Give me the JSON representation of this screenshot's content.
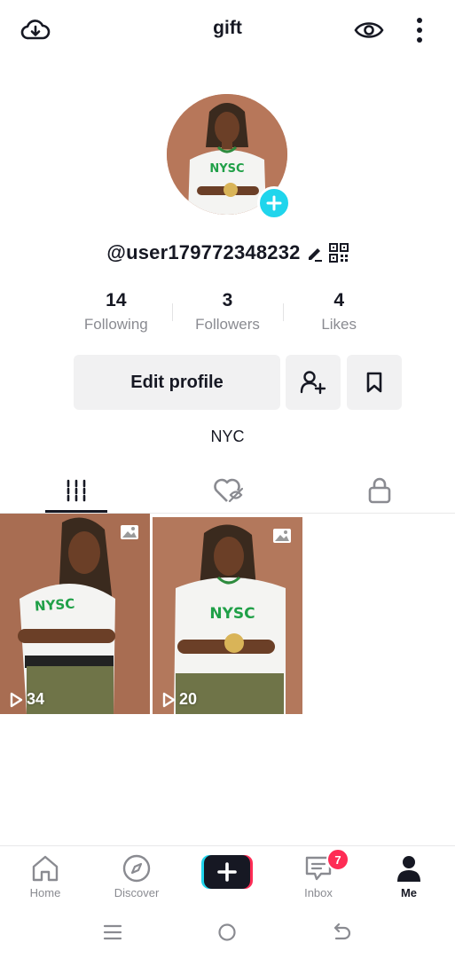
{
  "header": {
    "title": "gift",
    "left_icon": "cloud-download-icon",
    "right_icons": [
      "eye-icon",
      "more-vertical-icon"
    ]
  },
  "profile": {
    "username": "@user179772348232",
    "avatar_shirt_text": "NYSC",
    "bio": "NYC",
    "stats": [
      {
        "value": "14",
        "label": "Following"
      },
      {
        "value": "3",
        "label": "Followers"
      },
      {
        "value": "4",
        "label": "Likes"
      }
    ],
    "edit_label": "Edit profile"
  },
  "tabs": [
    {
      "icon": "videos-grid-icon",
      "active": true
    },
    {
      "icon": "liked-hidden-icon",
      "active": false
    },
    {
      "icon": "lock-icon",
      "active": false
    }
  ],
  "videos": [
    {
      "views": "34",
      "shirt_text": "NYSC"
    },
    {
      "views": "20",
      "shirt_text": "NYSC"
    }
  ],
  "bottom_nav": [
    {
      "label": "Home",
      "icon": "home-icon"
    },
    {
      "label": "Discover",
      "icon": "compass-icon"
    },
    {
      "label": "",
      "icon": "create-plus-icon"
    },
    {
      "label": "Inbox",
      "icon": "inbox-icon",
      "badge": "7"
    },
    {
      "label": "Me",
      "icon": "person-icon",
      "active": true
    }
  ],
  "colors": {
    "accent_cyan": "#20d5ec",
    "accent_red": "#fe2c55",
    "button_bg": "#f1f1f2",
    "muted_text": "#8a8b91",
    "text": "#161823"
  }
}
